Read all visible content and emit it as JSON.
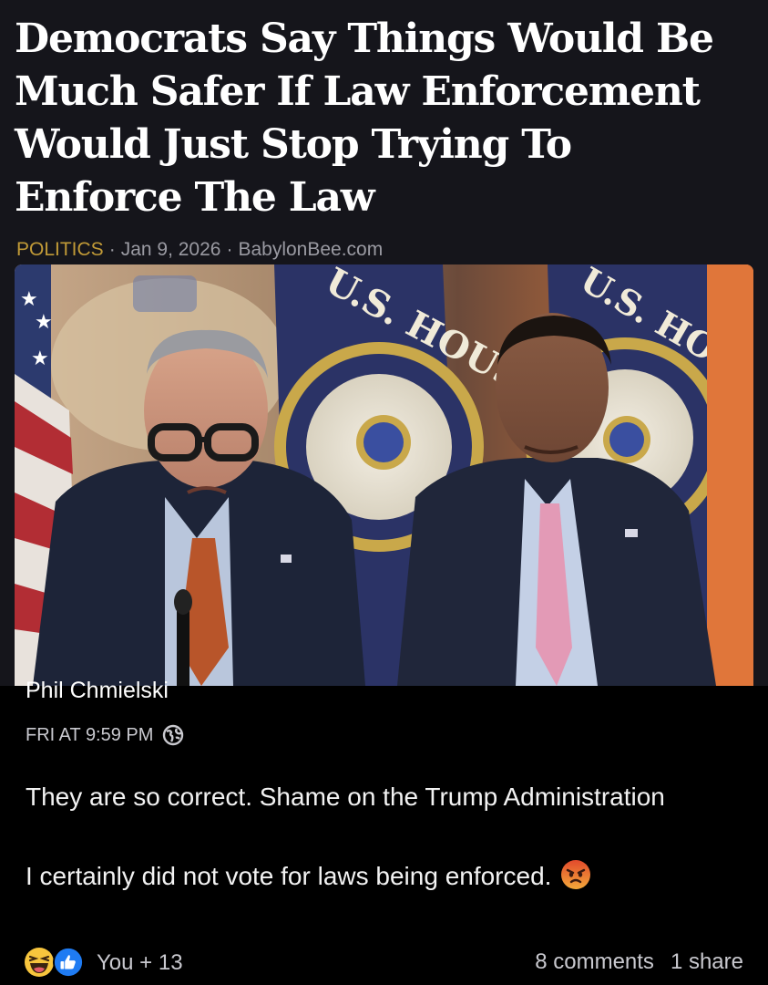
{
  "article": {
    "headline": "Democrats Say Things Would Be Much Safer If Law Enforcement Would Just Stop Trying To Enforce The Law",
    "category": "POLITICS",
    "date": "Jan 9, 2026",
    "source": "BabylonBee.com",
    "separator": "·",
    "category_color": "#c19a37"
  },
  "photo": {
    "seal_text": "U.S. HOUSE"
  },
  "post": {
    "author": "Phil Chmielski",
    "timestamp": "FRI AT 9:59 PM",
    "privacy_icon": "globe-icon",
    "text_line1": "They are so correct. Shame on the Trump Administration",
    "text_line2": "I certainly did not vote for laws being enforced.",
    "reaction_icon": "angry-face-icon"
  },
  "footer": {
    "reaction_icons": [
      "laugh-icon",
      "like-icon"
    ],
    "reactions_label": "You + 13",
    "comments": "8 comments",
    "shares": "1 share"
  }
}
